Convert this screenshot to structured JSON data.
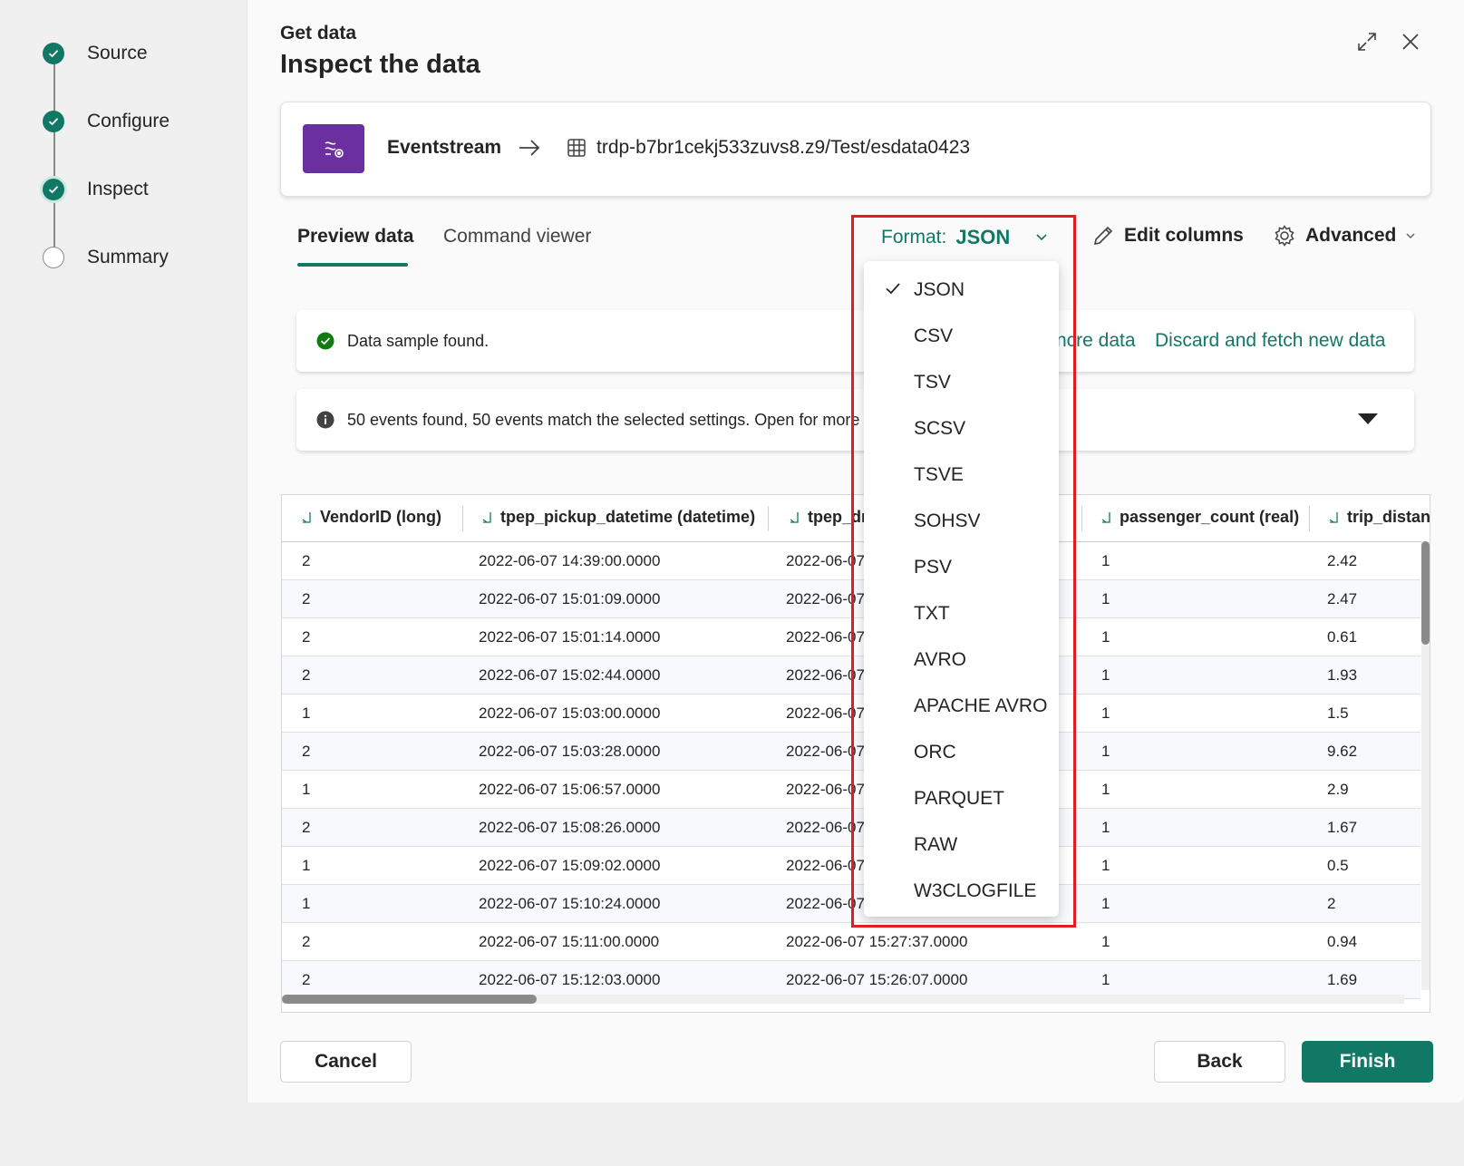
{
  "header": {
    "crumb": "Get data",
    "title": "Inspect the data"
  },
  "steps": [
    {
      "label": "Source",
      "state": "done"
    },
    {
      "label": "Configure",
      "state": "done"
    },
    {
      "label": "Inspect",
      "state": "current"
    },
    {
      "label": "Summary",
      "state": "todo"
    }
  ],
  "source": {
    "name": "Eventstream",
    "destination": "trdp-b7br1cekj533zuvs8.z9/Test/esdata0423"
  },
  "tabs": {
    "preview": "Preview data",
    "command": "Command viewer"
  },
  "toolbar": {
    "format_label": "Format:",
    "format_value": "JSON",
    "edit_columns": "Edit columns",
    "advanced": "Advanced"
  },
  "banners": {
    "sample_found": "Data sample found.",
    "more_data": "ncre data",
    "discard": "Discard and fetch new data",
    "events_info": "50 events found, 50 events match the selected settings. Open for more d"
  },
  "table": {
    "columns": [
      "VendorID (long)",
      "tpep_pickup_datetime (datetime)",
      "tpep_dr",
      "passenger_count (real)",
      "trip_distanc"
    ],
    "rows": [
      [
        "2",
        "2022-06-07 14:39:00.0000",
        "2022-06-07",
        "1",
        "2.42"
      ],
      [
        "2",
        "2022-06-07 15:01:09.0000",
        "2022-06-07",
        "1",
        "2.47"
      ],
      [
        "2",
        "2022-06-07 15:01:14.0000",
        "2022-06-07",
        "1",
        "0.61"
      ],
      [
        "2",
        "2022-06-07 15:02:44.0000",
        "2022-06-07",
        "1",
        "1.93"
      ],
      [
        "1",
        "2022-06-07 15:03:00.0000",
        "2022-06-07",
        "1",
        "1.5"
      ],
      [
        "2",
        "2022-06-07 15:03:28.0000",
        "2022-06-07",
        "1",
        "9.62"
      ],
      [
        "1",
        "2022-06-07 15:06:57.0000",
        "2022-06-07",
        "1",
        "2.9"
      ],
      [
        "2",
        "2022-06-07 15:08:26.0000",
        "2022-06-07",
        "1",
        "1.67"
      ],
      [
        "1",
        "2022-06-07 15:09:02.0000",
        "2022-06-07",
        "1",
        "0.5"
      ],
      [
        "1",
        "2022-06-07 15:10:24.0000",
        "2022-06-07",
        "1",
        "2"
      ],
      [
        "2",
        "2022-06-07 15:11:00.0000",
        "2022-06-07 15:27:37.0000",
        "1",
        "0.94"
      ],
      [
        "2",
        "2022-06-07 15:12:03.0000",
        "2022-06-07 15:26:07.0000",
        "1",
        "1.69"
      ]
    ]
  },
  "format_menu": {
    "options": [
      "JSON",
      "CSV",
      "TSV",
      "SCSV",
      "TSVE",
      "SOHSV",
      "PSV",
      "TXT",
      "AVRO",
      "APACHE AVRO",
      "ORC",
      "PARQUET",
      "RAW",
      "W3CLOGFILE"
    ],
    "selected": "JSON"
  },
  "footer": {
    "cancel": "Cancel",
    "back": "Back",
    "finish": "Finish"
  },
  "colors": {
    "accent": "#117865",
    "eventstream": "#6b2fa0",
    "highlight": "#e31b23"
  }
}
